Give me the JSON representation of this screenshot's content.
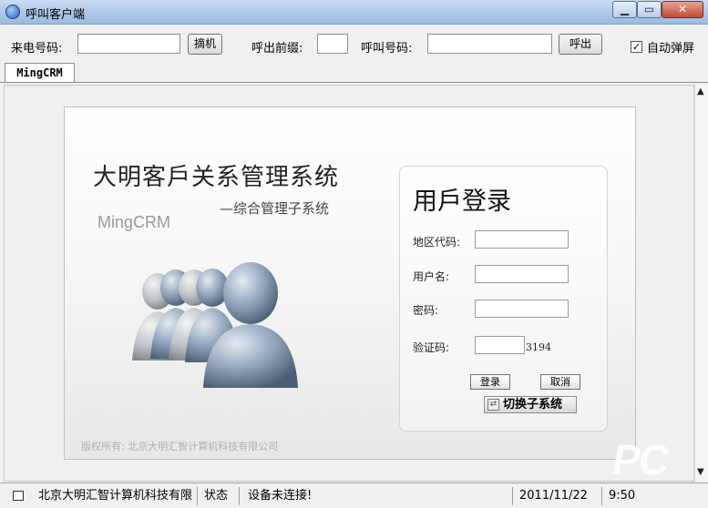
{
  "window": {
    "title": "呼叫客户端"
  },
  "toolbar": {
    "incoming_label": "来电号码:",
    "incoming_value": "",
    "hangup_label": "摘机",
    "prefix_label": "呼出前缀:",
    "prefix_value": "",
    "call_number_label": "呼叫号码:",
    "call_number_value": "",
    "call_button": "呼出",
    "auto_popup_label": "自动弹屏",
    "auto_popup_checked": true
  },
  "tabs": [
    {
      "label": "MingCRM",
      "active": true
    }
  ],
  "panel": {
    "main_title": "大明客戶关系管理系统",
    "subtitle": "—综合管理子系统",
    "brand": "MingCRM",
    "copyright": "版权所有: 北京大明汇智计算机科技有限公司"
  },
  "login": {
    "title": "用戶登录",
    "fields": [
      {
        "label": "地区代码:",
        "value": ""
      },
      {
        "label": "用户名:",
        "value": ""
      },
      {
        "label": "密码:",
        "value": ""
      },
      {
        "label": "验证码:",
        "value": ""
      }
    ],
    "captcha_code": "3194",
    "login_button": "登录",
    "cancel_button": "取消",
    "switch_button": "切换子系统"
  },
  "watermark": "PC",
  "statusbar": {
    "company": "北京大明汇智计算机科技有限公司",
    "status_label": "状态",
    "status_value": "设备未连接!",
    "date": "2011/11/22",
    "time": "9:50"
  }
}
